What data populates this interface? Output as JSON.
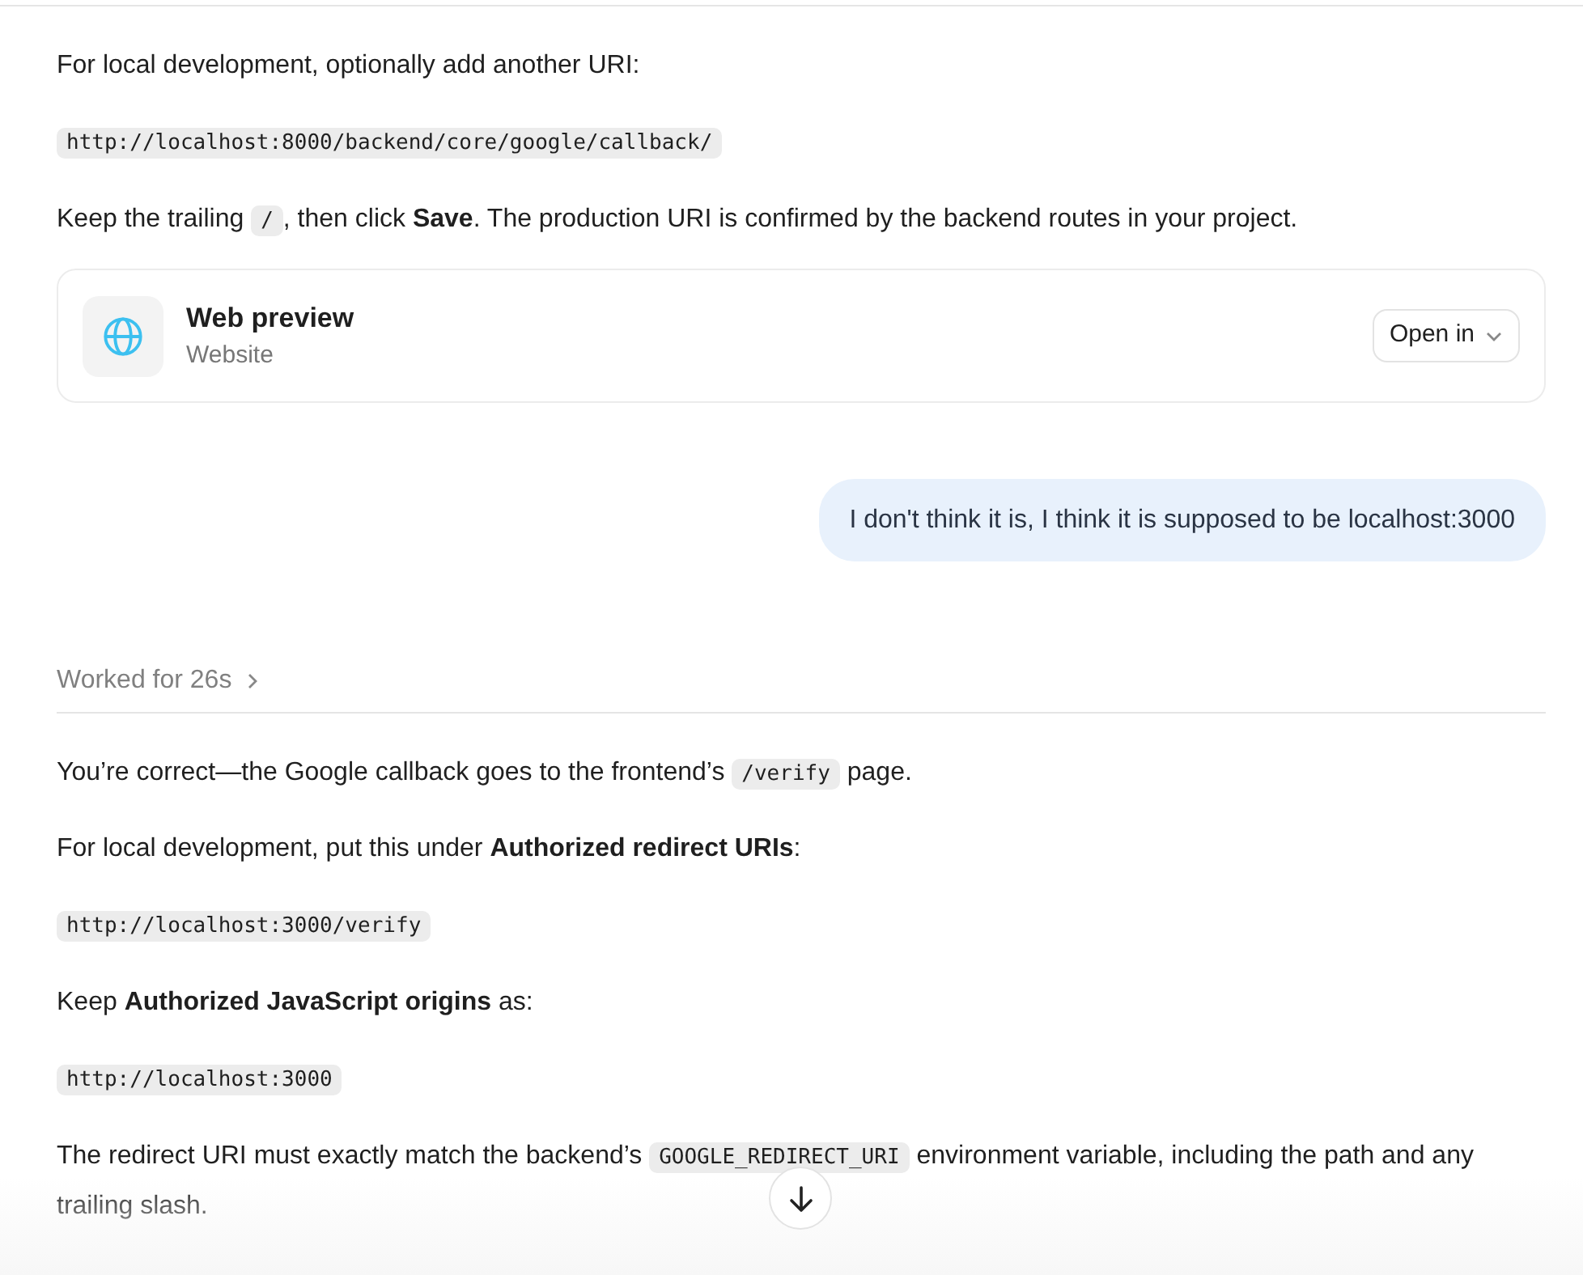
{
  "blocks": [
    {
      "kind": "paragraph",
      "segments": [
        {
          "kind": "text",
          "text": "For local development, optionally add another URI:"
        }
      ]
    },
    {
      "kind": "code",
      "text": "http://localhost:8000/backend/core/google/callback/"
    },
    {
      "kind": "paragraph",
      "segments": [
        {
          "kind": "text",
          "text": "Keep the trailing "
        },
        {
          "kind": "code",
          "text": "/"
        },
        {
          "kind": "text",
          "text": ", then click **Save**. The production URI is confirmed by the backend routes in your project."
        }
      ]
    },
    {
      "kind": "preview",
      "title": "Web preview",
      "subtitle": "Website",
      "button": "Open in"
    },
    {
      "kind": "user",
      "text": "I don't think it is, I think it is supposed to be localhost:3000"
    },
    {
      "kind": "worked",
      "text": "Worked for 26s",
      "expanded": false
    },
    {
      "kind": "paragraph",
      "segments": [
        {
          "kind": "text",
          "text": "You’re correct—the Google callback goes to the frontend’s "
        },
        {
          "kind": "code",
          "text": "/verify"
        },
        {
          "kind": "text",
          "text": " page."
        }
      ]
    },
    {
      "kind": "paragraph",
      "segments": [
        {
          "kind": "text",
          "text": "For local development, put this under **Authorized redirect URIs**:"
        }
      ]
    },
    {
      "kind": "code",
      "text": "http://localhost:3000/verify"
    },
    {
      "kind": "paragraph",
      "segments": [
        {
          "kind": "text",
          "text": "Keep **Authorized JavaScript origins** as:"
        }
      ]
    },
    {
      "kind": "code",
      "text": "http://localhost:3000"
    },
    {
      "kind": "paragraph",
      "segments": [
        {
          "kind": "text",
          "text": "The redirect URI must exactly match the backend’s "
        },
        {
          "kind": "code",
          "text": "GOOGLE_REDIRECT_URI"
        },
        {
          "kind": "text",
          "text": " environment variable, including the path and any trailing slash."
        }
      ]
    }
  ]
}
